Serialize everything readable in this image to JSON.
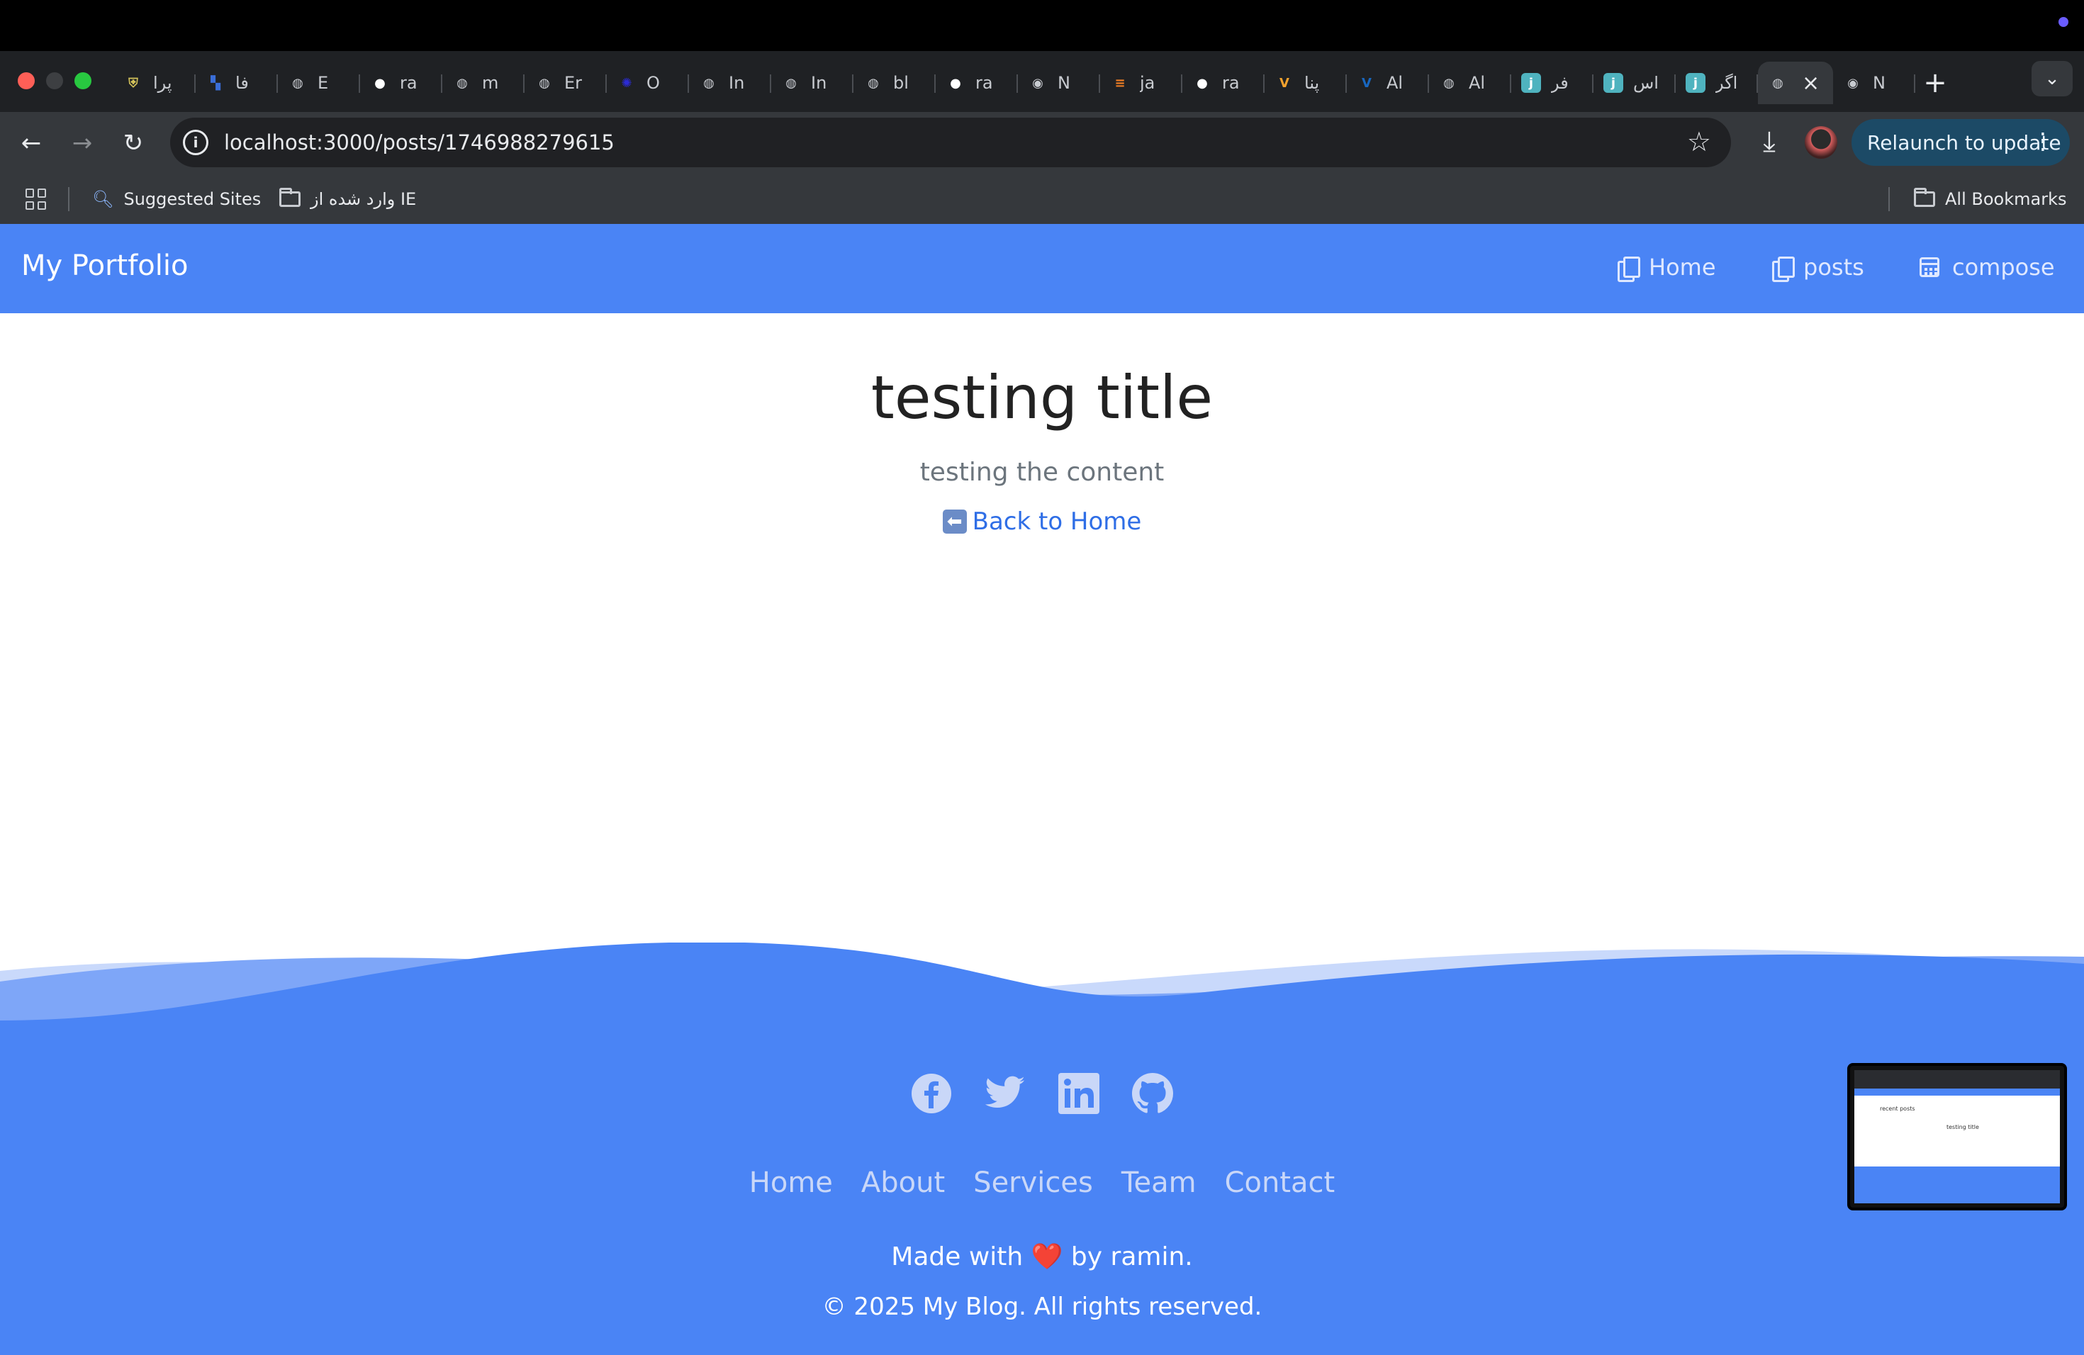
{
  "browser": {
    "tabs": [
      {
        "label": "پرا",
        "icon": "shield-icon",
        "color": "#d4c35a"
      },
      {
        "label": "فا",
        "icon": "chart-icon",
        "color": "#3a6ed8"
      },
      {
        "label": "E",
        "icon": "globe-icon",
        "color": "#c8cbd0"
      },
      {
        "label": "ra",
        "icon": "github-icon",
        "color": "#ffffff"
      },
      {
        "label": "m",
        "icon": "globe-icon",
        "color": "#c8cbd0"
      },
      {
        "label": "Er",
        "icon": "globe-icon",
        "color": "#c8cbd0"
      },
      {
        "label": "O",
        "icon": "openai-icon",
        "color": "#2b2bd6"
      },
      {
        "label": "In",
        "icon": "globe-icon",
        "color": "#c8cbd0"
      },
      {
        "label": "In",
        "icon": "globe-icon",
        "color": "#c8cbd0"
      },
      {
        "label": "bl",
        "icon": "globe-icon",
        "color": "#c8cbd0"
      },
      {
        "label": "ra",
        "icon": "github-icon",
        "color": "#ffffff"
      },
      {
        "label": "N",
        "icon": "chrome-icon",
        "color": "#c8cbd0"
      },
      {
        "label": "ja",
        "icon": "stackoverflow-icon",
        "color": "#f48024"
      },
      {
        "label": "ra",
        "icon": "github-icon",
        "color": "#ffffff"
      },
      {
        "label": "پنا",
        "icon": "vuetify-icon",
        "color": "#f2a22e"
      },
      {
        "label": "Al",
        "icon": "vuetify-icon",
        "color": "#1867c0"
      },
      {
        "label": "Al",
        "icon": "globe-icon",
        "color": "#c8cbd0"
      },
      {
        "label": "فر",
        "icon": "j-icon",
        "color": "#4fb3bf"
      },
      {
        "label": "اس",
        "icon": "j-icon",
        "color": "#4fb3bf"
      },
      {
        "label": "اگر",
        "icon": "j-icon",
        "color": "#4fb3bf"
      }
    ],
    "active_tab": {
      "icon": "globe-icon"
    },
    "after_active_tab": {
      "label": "N",
      "icon": "chrome-icon"
    },
    "url": "localhost:3000/posts/1746988279615",
    "relaunch_label": "Relaunch to update",
    "bookmarks": {
      "suggested_sites": "Suggested Sites",
      "imported_folder": "وارد شده از IE",
      "all_bookmarks": "All Bookmarks"
    }
  },
  "site": {
    "brand": "My Portfolio",
    "nav": [
      {
        "label": "Home",
        "icon": "copy-icon"
      },
      {
        "label": "posts",
        "icon": "copy-icon"
      },
      {
        "label": "compose",
        "icon": "calendar-icon"
      }
    ],
    "post": {
      "title": "testing title",
      "content": "testing the content",
      "back_link": "Back to Home"
    },
    "footer": {
      "socials": [
        "facebook-icon",
        "twitter-icon",
        "linkedin-icon",
        "github-icon"
      ],
      "links": [
        "Home",
        "About",
        "Services",
        "Team",
        "Contact"
      ],
      "made_with": "Made with ❤️ by ramin.",
      "copyright": "© 2025 My Blog. All rights reserved."
    },
    "thumbnail": {
      "heading": "recent posts",
      "title": "testing title"
    },
    "colors": {
      "primary": "#4a84f5",
      "link": "#2f6ee6",
      "title_text": "#222222"
    }
  }
}
